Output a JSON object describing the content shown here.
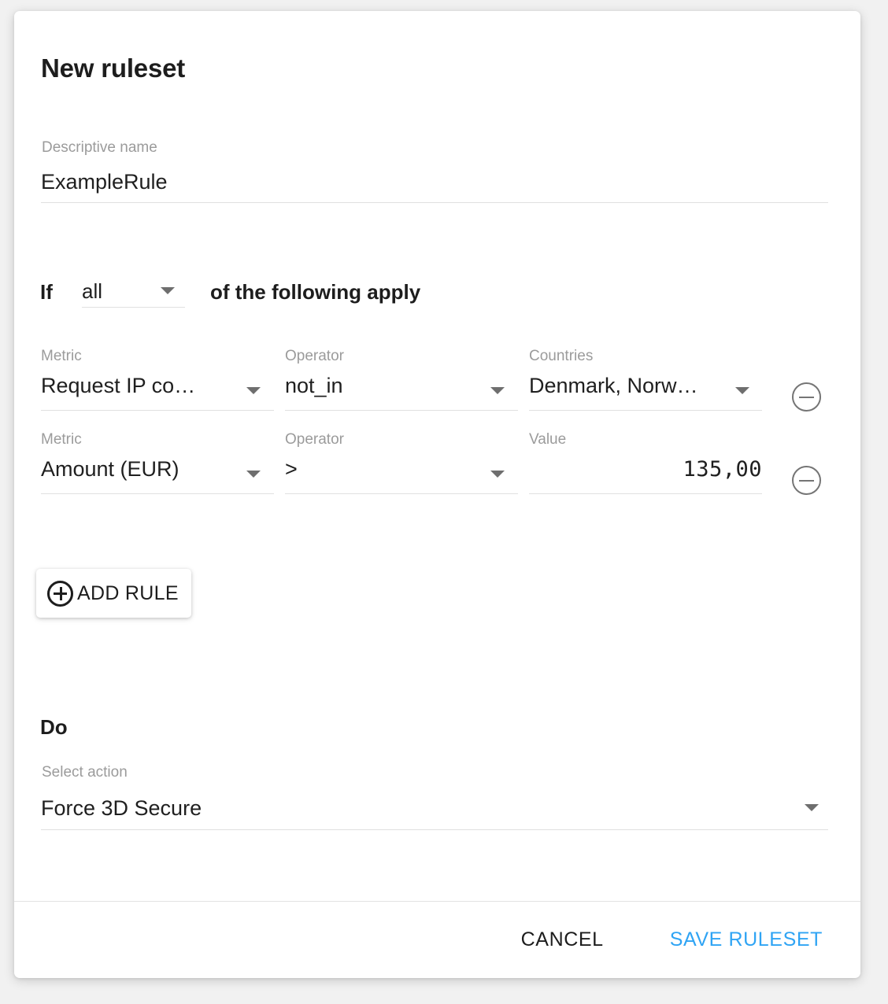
{
  "dialog": {
    "title": "New ruleset",
    "name_field": {
      "label": "Descriptive name",
      "value": "ExampleRule"
    },
    "condition_header": {
      "prefix": "If",
      "scope_value": "all",
      "suffix": "of the following apply"
    },
    "rules": [
      {
        "metric_label": "Metric",
        "metric_value": "Request IP co…",
        "operator_label": "Operator",
        "operator_value": "not_in",
        "third_label": "Countries",
        "third_value": "Denmark, Norw…",
        "remove_title": "Remove rule"
      },
      {
        "metric_label": "Metric",
        "metric_value": "Amount (EUR)",
        "operator_label": "Operator",
        "operator_value": ">",
        "third_label": "Value",
        "third_value": "135,00",
        "remove_title": "Remove rule"
      }
    ],
    "add_rule_label": "ADD RULE",
    "action_section": {
      "heading": "Do",
      "label": "Select action",
      "value": "Force 3D Secure"
    },
    "footer": {
      "cancel_label": "CANCEL",
      "save_label": "SAVE RULESET"
    },
    "colors": {
      "accent": "#2fa4f4",
      "label_gray": "#9b9b9b",
      "text_dark": "#1d1d1d",
      "underline": "#e0e0e0",
      "page_background": "#f1f1f1",
      "card_background": "#ffffff"
    },
    "icons": {
      "caret": "chevron-down-icon",
      "remove": "minus-circle-icon",
      "add": "plus-circle-icon"
    }
  }
}
